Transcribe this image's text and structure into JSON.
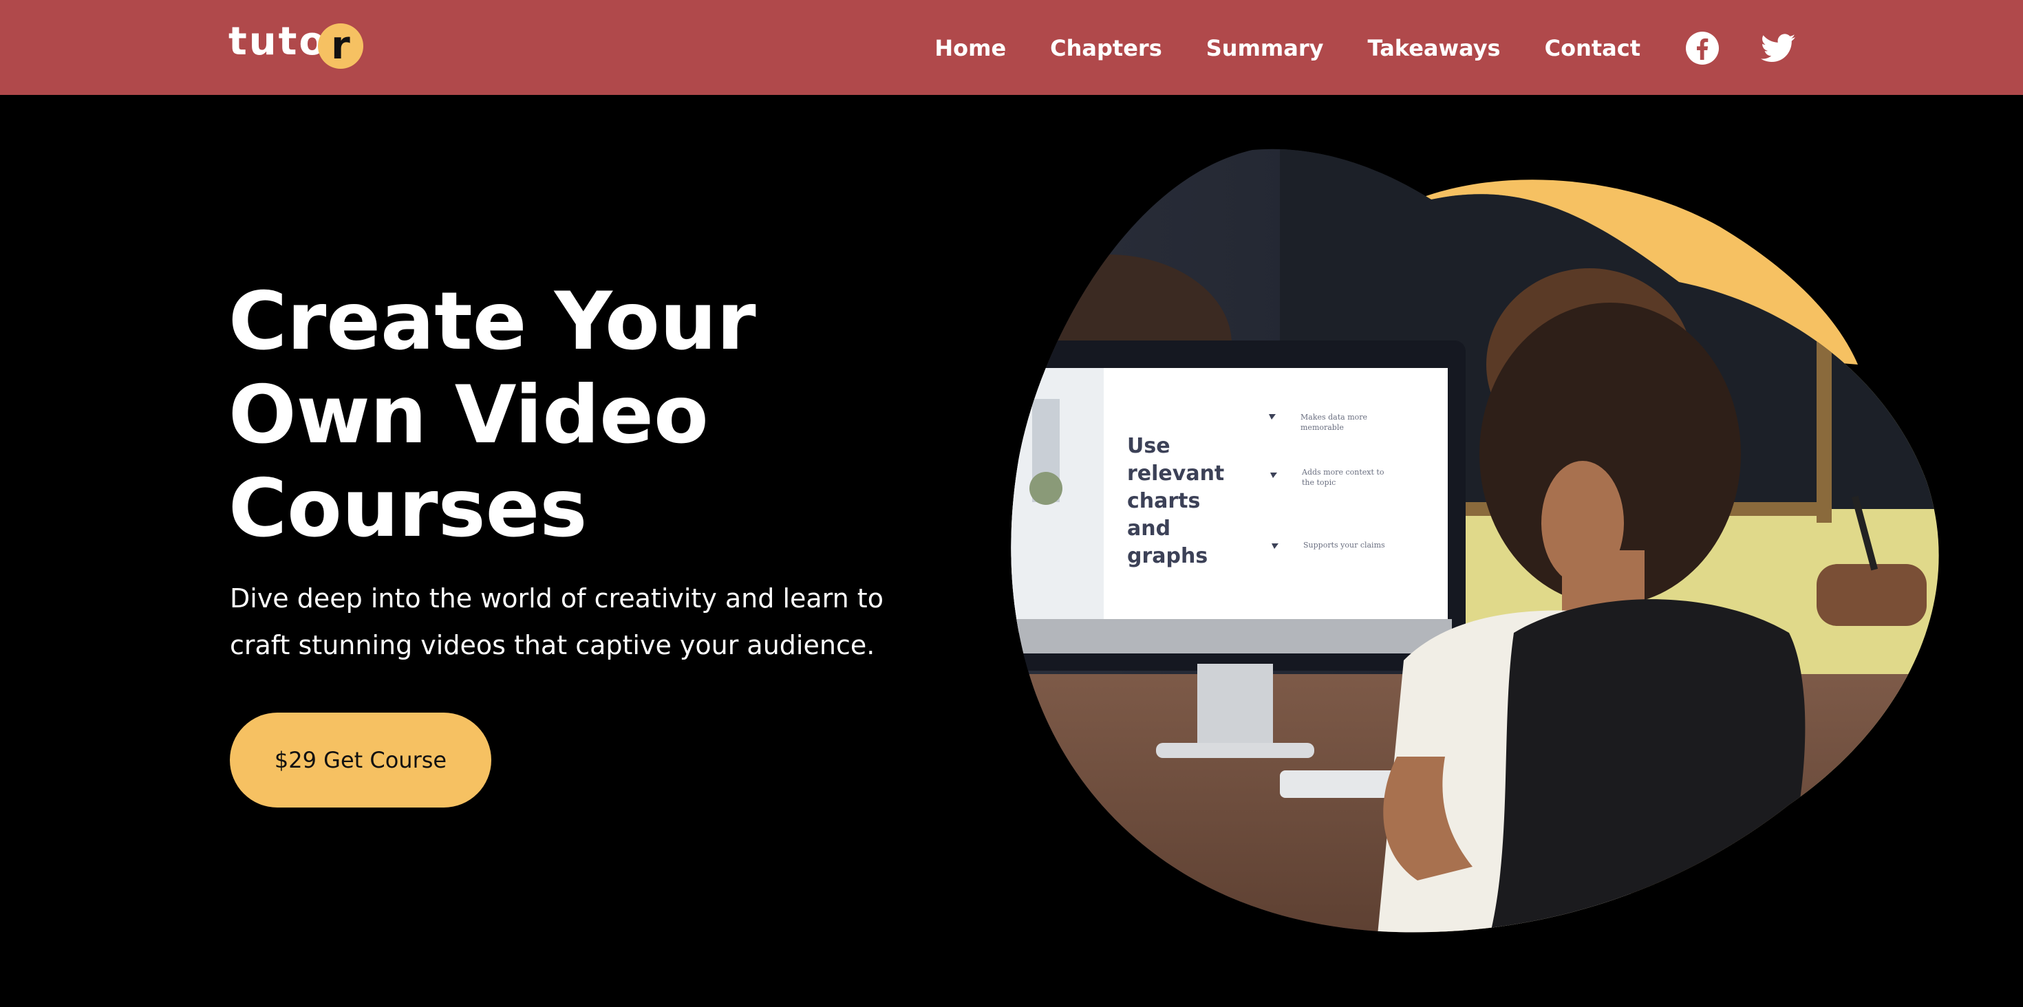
{
  "brand": {
    "logo_text": "tuto",
    "logo_letter": "r"
  },
  "nav": {
    "items": [
      {
        "label": "Home"
      },
      {
        "label": "Chapters"
      },
      {
        "label": "Summary"
      },
      {
        "label": "Takeaways"
      },
      {
        "label": "Contact"
      }
    ],
    "social": [
      {
        "icon": "facebook-icon"
      },
      {
        "icon": "twitter-icon"
      }
    ]
  },
  "hero": {
    "title": "Create Your\nOwn Video\nCourses",
    "subtitle": "Dive deep into the world of creativity and learn to craft stunning videos that captive your audience.",
    "cta_label": "$29 Get Course"
  },
  "screen_slide": {
    "heading_lines": [
      "Use",
      "relevant",
      "charts",
      "and",
      "graphs"
    ],
    "bullets": [
      [
        "Makes data more",
        "memorable"
      ],
      [
        "Adds more context to",
        "the topic"
      ],
      [
        "Supports your claims"
      ]
    ]
  },
  "colors": {
    "header_bg": "#b0494b",
    "accent": "#f6c162",
    "background": "#000000",
    "text": "#ffffff"
  }
}
